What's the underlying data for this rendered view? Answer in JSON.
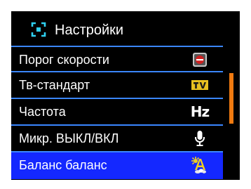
{
  "header": {
    "title": "Настройки",
    "icon": "settings-icon"
  },
  "menu": {
    "items": [
      {
        "label": "Порог скорости",
        "icon": "speed-threshold-icon"
      },
      {
        "label": "Тв-стандарт",
        "icon": "tv-icon"
      },
      {
        "label": "Частота",
        "icon": "frequency-hz-icon",
        "icon_text": "Hz"
      },
      {
        "label": "Микр. ВЫКЛ/ВКЛ",
        "icon": "microphone-icon"
      },
      {
        "label": "Баланс баланс",
        "icon": "white-balance-icon",
        "selected": true
      }
    ]
  },
  "colors": {
    "background": "#000000",
    "divider": "#3a86ff",
    "selected": "#1428ff",
    "scrollbar": "#f07a10",
    "accent_cyan": "#2fd0f0"
  },
  "scroll": {
    "position_fraction": 0.33
  }
}
